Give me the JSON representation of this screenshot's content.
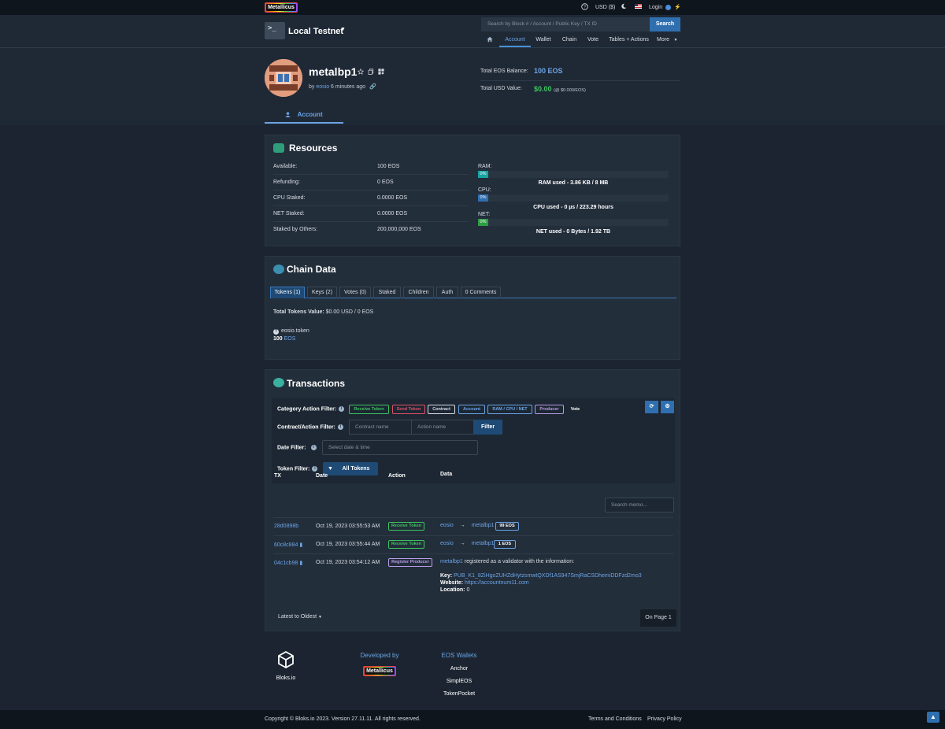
{
  "topbar": {
    "brand": "Metallicus",
    "currency": "USD ($)",
    "login": "Login"
  },
  "header": {
    "network": "Local Testnet",
    "search_placeholder": "Search by Block # / Account / Public Key / TX ID",
    "search_button": "Search",
    "nav": [
      "Account",
      "Wallet",
      "Chain",
      "Vote",
      "Tables + Actions",
      "More"
    ]
  },
  "profile": {
    "account_name": "metalbp1",
    "by_prefix": "by",
    "creator": "eosio",
    "created_ago": "6 minutes ago",
    "total_eos_label": "Total EOS Balance:",
    "total_eos_value": "100 EOS",
    "total_usd_label": "Total USD Value:",
    "total_usd_value": "$0.00",
    "usd_rate": "(@ $0.000/EOS)",
    "tab_account": "Account"
  },
  "resources": {
    "title": "Resources",
    "rows": [
      {
        "label": "Available:",
        "value": "100 EOS"
      },
      {
        "label": "Refunding:",
        "value": "0 EOS"
      },
      {
        "label": "CPU Staked:",
        "value": "0.0000 EOS"
      },
      {
        "label": "NET Staked:",
        "value": "0.0000 EOS"
      },
      {
        "label": "Staked by Others:",
        "value": "200,000,000 EOS"
      }
    ],
    "meters": [
      {
        "label": "RAM:",
        "percent": "0%",
        "text": "RAM used - 3.86 KB / 8 MB",
        "color": "#1aa3a3",
        "fraction": 0.0
      },
      {
        "label": "CPU:",
        "percent": "0%",
        "text": "CPU used - 0 µs / 223.29 hours",
        "color": "#2f6fb0",
        "fraction": 0.0
      },
      {
        "label": "NET:",
        "percent": "0%",
        "text": "NET used - 0 Bytes / 1.92 TB",
        "color": "#2e9e44",
        "fraction": 0.0
      }
    ]
  },
  "chain_data": {
    "title": "Chain Data",
    "tabs": [
      "Tokens (1)",
      "Keys (2)",
      "Votes (0)",
      "Staked",
      "Children",
      "Auth",
      "0 Comments"
    ],
    "total_tokens_label": "Total Tokens Value:",
    "total_tokens_value": "$0.00 USD / 0 EOS",
    "token_contract": "eosio.token",
    "token_amount": "100",
    "token_symbol": "EOS"
  },
  "transactions": {
    "title": "Transactions",
    "category_label": "Category Action Filter:",
    "chips": [
      {
        "label": "Receive Token",
        "color": "#3ec35f"
      },
      {
        "label": "Send Token",
        "color": "#e0506a"
      },
      {
        "label": "Contract",
        "color": "#d8dde3"
      },
      {
        "label": "Account",
        "color": "#6ba4e6"
      },
      {
        "label": "RAM / CPU / NET",
        "color": "#6ba4e6"
      },
      {
        "label": "Producer",
        "color": "#b89be6"
      },
      {
        "label": "Vote",
        "color": "#ffffff"
      }
    ],
    "contract_label": "Contract/Action Filter:",
    "contract_placeholder": "Contract name",
    "action_placeholder": "Action name",
    "filter_button": "Filter",
    "date_label": "Date Filter:",
    "date_placeholder": "Select date & time",
    "token_label": "Token Filter:",
    "all_tokens": "All Tokens",
    "columns": [
      "TX",
      "Date",
      "Action",
      "Data"
    ],
    "memo_placeholder": "Search memo...",
    "rows": [
      {
        "tx": "28d0898b",
        "date": "Oct 19, 2023 03:55:53 AM",
        "action": "Receive Token",
        "from": "eosio",
        "to": "metalbp1",
        "amount": "99 EOS"
      },
      {
        "tx": "60c8c884",
        "date": "Oct 19, 2023 03:55:44 AM",
        "action": "Receive Token",
        "from": "eosio",
        "to": "metalbp1",
        "amount": "1 EOS"
      },
      {
        "tx": "04c1cb98",
        "date": "Oct 19, 2023 03:54:12 AM",
        "action": "Register Producer",
        "account": "metalbp1",
        "desc": "registered as a validator with the information:",
        "key_label": "Key:",
        "key": "PUB_K1_8ZiHgoZUHZdHytzsmwtQXDf1AS947SmjRaCSDhemiDDFzd2mo3",
        "website_label": "Website:",
        "website": "https://accountnum11.com",
        "location_label": "Location:",
        "location": "0"
      }
    ],
    "sort": "Latest to Oldest",
    "page": "On Page 1"
  },
  "footer": {
    "brand": "Bloks.io",
    "developed_by": "Developed by",
    "dev_brand": "Metallicus",
    "wallets_title": "EOS Wallets",
    "wallets": [
      "Anchor",
      "SimplEOS",
      "TokenPocket"
    ],
    "copyright": "Copyright © Bloks.io 2023. Version 27.11.11. All rights reserved.",
    "terms": "Terms and Conditions",
    "privacy": "Privacy Policy"
  }
}
